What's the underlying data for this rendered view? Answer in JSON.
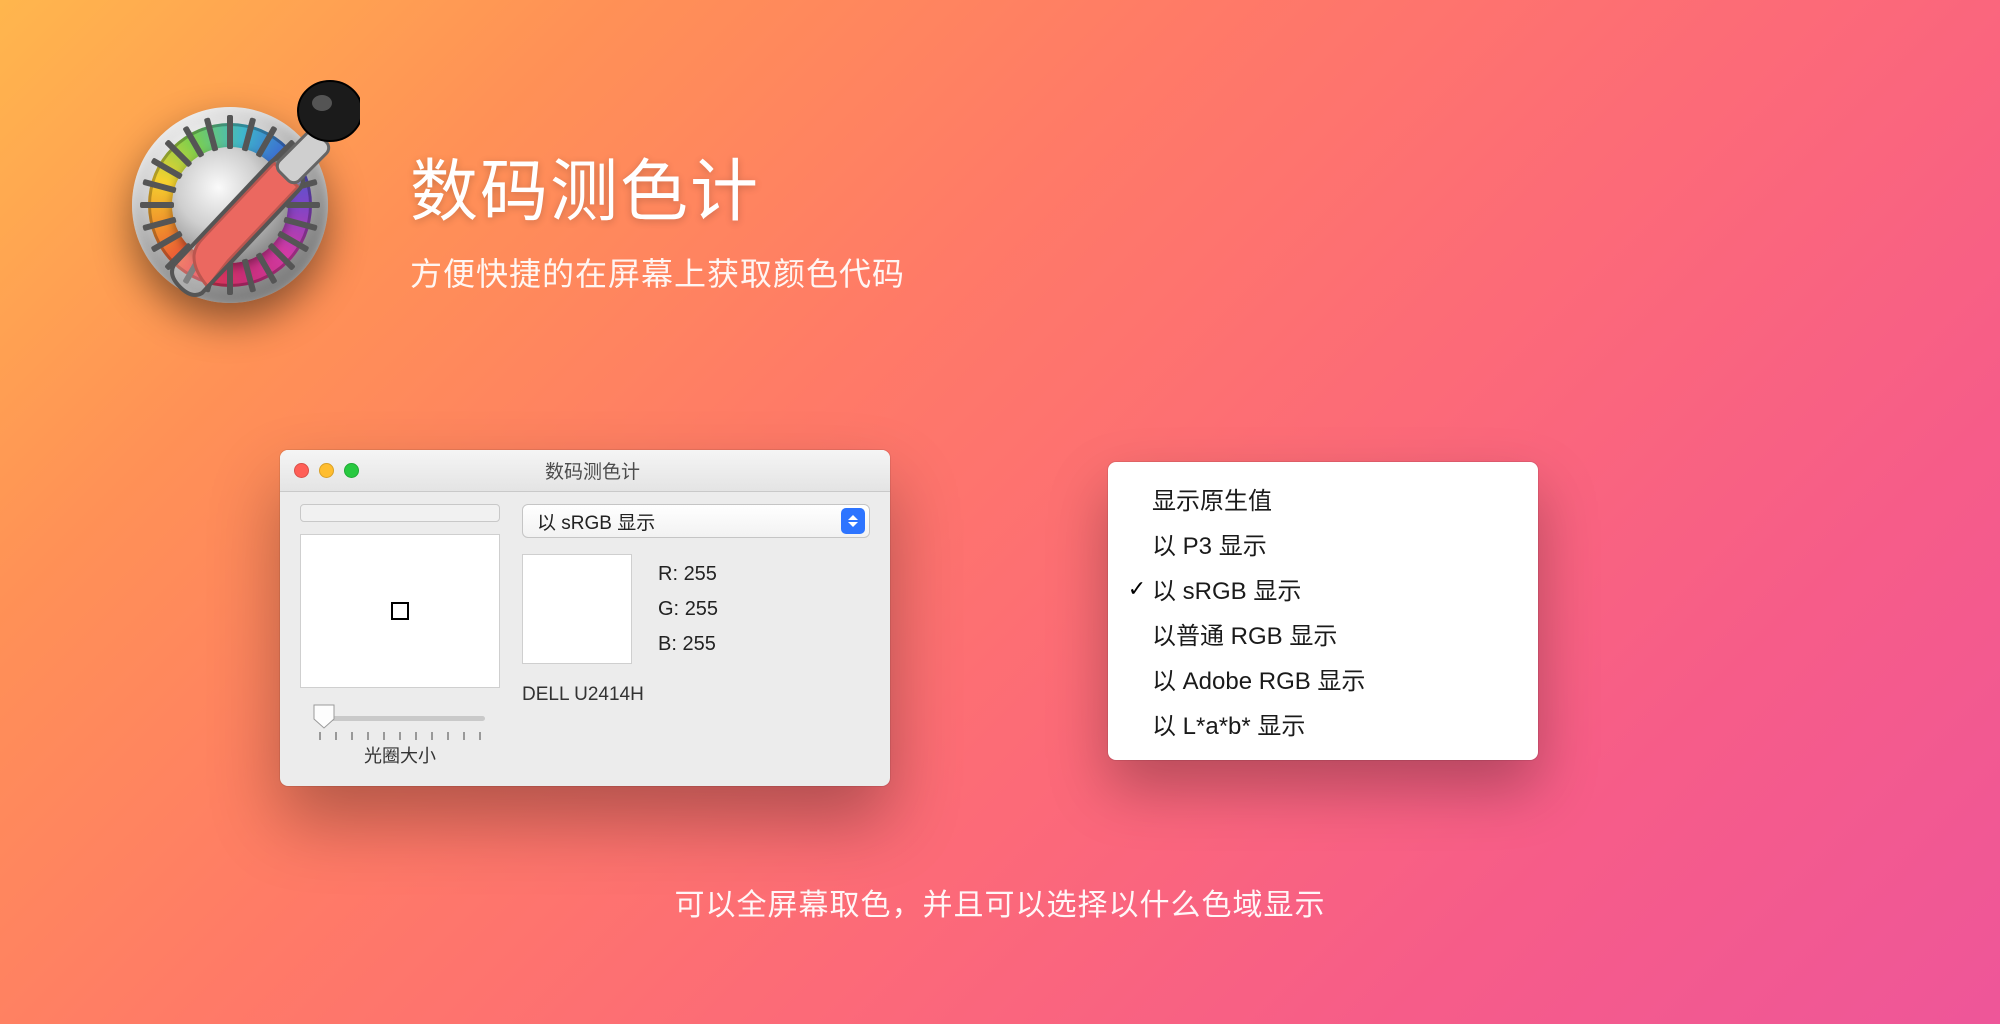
{
  "hero": {
    "title": "数码测色计",
    "subtitle": "方便快捷的在屏幕上获取颜色代码"
  },
  "window": {
    "title": "数码测色计",
    "popup_selected": "以 sRGB 显示",
    "rgb": {
      "r_label": "R:",
      "r_value": "255",
      "g_label": "G:",
      "g_value": "255",
      "b_label": "B:",
      "b_value": "255"
    },
    "display_name": "DELL U2414H",
    "slider_label": "光圈大小"
  },
  "menu": {
    "items": [
      {
        "label": "显示原生值",
        "checked": false
      },
      {
        "label": "以 P3 显示",
        "checked": false
      },
      {
        "label": "以 sRGB 显示",
        "checked": true
      },
      {
        "label": "以普通 RGB 显示",
        "checked": false
      },
      {
        "label": "以 Adobe RGB 显示",
        "checked": false
      },
      {
        "label": "以 L*a*b* 显示",
        "checked": false
      }
    ]
  },
  "caption": "可以全屏幕取色，并且可以选择以什么色域显示"
}
